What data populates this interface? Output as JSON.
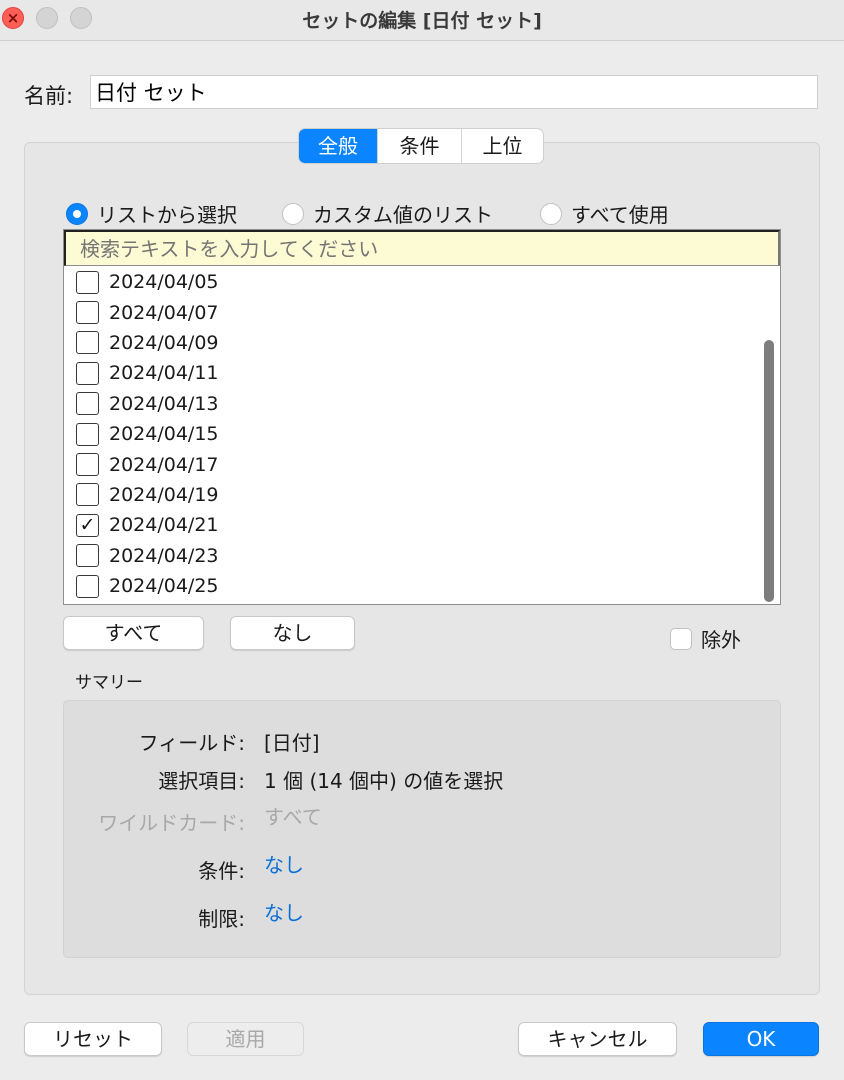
{
  "window": {
    "title": "セットの編集 [日付 セット]"
  },
  "name_field": {
    "label": "名前:",
    "value": "日付 セット"
  },
  "tabs": [
    {
      "label": "全般",
      "active": true
    },
    {
      "label": "条件",
      "active": false
    },
    {
      "label": "上位",
      "active": false
    }
  ],
  "radios": [
    {
      "label": "リストから選択",
      "selected": true
    },
    {
      "label": "カスタム値のリスト",
      "selected": false
    },
    {
      "label": "すべて使用",
      "selected": false
    }
  ],
  "search": {
    "placeholder": "検索テキストを入力してください"
  },
  "list_items": [
    {
      "label": "2024/04/05",
      "checked": false
    },
    {
      "label": "2024/04/07",
      "checked": false
    },
    {
      "label": "2024/04/09",
      "checked": false
    },
    {
      "label": "2024/04/11",
      "checked": false
    },
    {
      "label": "2024/04/13",
      "checked": false
    },
    {
      "label": "2024/04/15",
      "checked": false
    },
    {
      "label": "2024/04/17",
      "checked": false
    },
    {
      "label": "2024/04/19",
      "checked": false
    },
    {
      "label": "2024/04/21",
      "checked": true
    },
    {
      "label": "2024/04/23",
      "checked": false
    },
    {
      "label": "2024/04/25",
      "checked": false
    }
  ],
  "list_buttons": {
    "all": "すべて",
    "none": "なし"
  },
  "exclude": {
    "label": "除外",
    "checked": false
  },
  "summary": {
    "title": "サマリー",
    "field_label": "フィールド:",
    "field_value": "[日付]",
    "selection_label": "選択項目:",
    "selection_value": "1 個 (14 個中) の値を選択",
    "wildcard_label": "ワイルドカード:",
    "wildcard_value": "すべて",
    "condition_label": "条件:",
    "condition_value": "なし",
    "limit_label": "制限:",
    "limit_value": "なし"
  },
  "footer": {
    "reset": "リセット",
    "apply": "適用",
    "cancel": "キャンセル",
    "ok": "OK"
  },
  "colors": {
    "accent": "#0a84ff",
    "search_bg": "#fdfbd3",
    "link": "#0a6fd6"
  }
}
